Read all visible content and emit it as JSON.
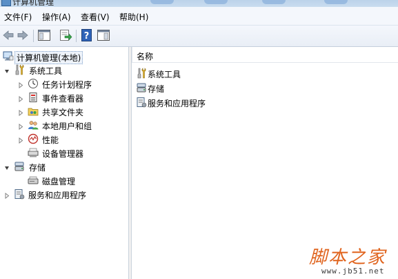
{
  "window": {
    "title": "计算机管理"
  },
  "menu": [
    "文件(F)",
    "操作(A)",
    "查看(V)",
    "帮助(H)"
  ],
  "toolbar": {
    "buttons": [
      "back-arrow-icon",
      "forward-arrow-icon",
      "show-hide-tree-icon",
      "export-list-icon",
      "help-icon",
      "properties-pane-icon"
    ]
  },
  "tree": {
    "root": "计算机管理(本地)",
    "system_tools": "系统工具",
    "task_scheduler": "任务计划程序",
    "event_viewer": "事件查看器",
    "shared_folders": "共享文件夹",
    "local_users": "本地用户和组",
    "performance": "性能",
    "device_manager": "设备管理器",
    "storage": "存储",
    "disk_management": "磁盘管理",
    "services": "服务和应用程序"
  },
  "list": {
    "column_name": "名称",
    "items": [
      "系统工具",
      "存储",
      "服务和应用程序"
    ]
  },
  "watermark": {
    "title": "脚本之家",
    "url": "www.jb51.net"
  },
  "colors": {
    "menubar": "#f4f7fc",
    "selection": "#eef3fa",
    "watermark": "#e0641e"
  }
}
